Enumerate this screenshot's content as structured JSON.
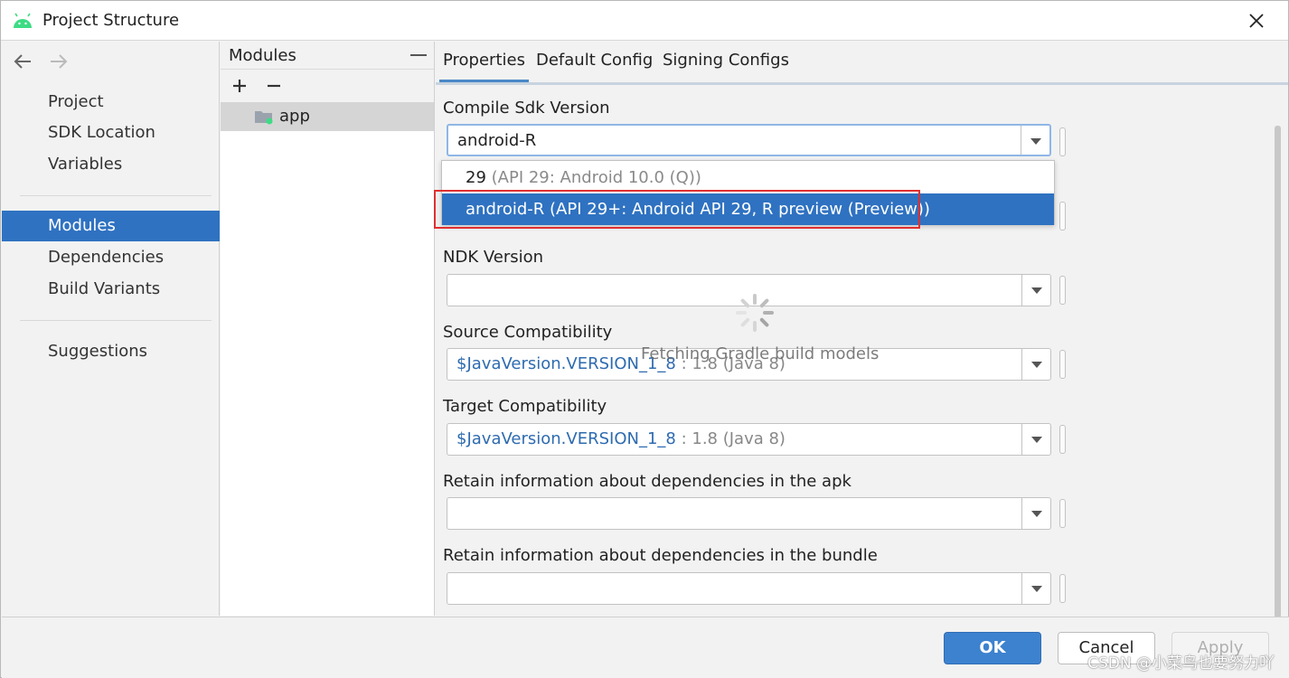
{
  "window": {
    "title": "Project Structure",
    "icon": "android-icon",
    "close_icon": "close-icon"
  },
  "nav": {
    "back_icon": "arrow-left-icon",
    "forward_icon": "arrow-right-icon",
    "group1": [
      "Project",
      "SDK Location",
      "Variables"
    ],
    "group2": [
      "Modules",
      "Dependencies",
      "Build Variants"
    ],
    "group3": [
      "Suggestions"
    ],
    "selected": "Modules",
    "selected_color": "#2f72c1"
  },
  "modules": {
    "title": "Modules",
    "add_icon": "plus-icon",
    "remove_icon": "minus-icon",
    "items": [
      {
        "label": "app",
        "icon": "module-folder-icon"
      }
    ]
  },
  "tabs": [
    "Properties",
    "Default Config",
    "Signing Configs"
  ],
  "active_tab": "Properties",
  "fields": {
    "compile_sdk": {
      "label": "Compile Sdk Version",
      "value": "android-R"
    },
    "ndk": {
      "label": "NDK Version",
      "value": ""
    },
    "source_compat": {
      "label": "Source Compatibility",
      "value_link": "$JavaVersion.VERSION_1_8",
      "value_dim": " : 1.8 (Java 8)"
    },
    "target_compat": {
      "label": "Target Compatibility",
      "value_link": "$JavaVersion.VERSION_1_8",
      "value_dim": " : 1.8 (Java 8)"
    },
    "retain_apk": {
      "label": "Retain information about dependencies in the apk",
      "value": ""
    },
    "retain_bundle": {
      "label": "Retain information about dependencies in the bundle",
      "value": ""
    }
  },
  "dropdown": {
    "items": [
      {
        "main": "29",
        "dim": " (API 29: Android 10.0 (Q))"
      },
      {
        "main": "android-R (API 29+: Android API 29, R preview (Preview))",
        "dim": ""
      }
    ],
    "selected_index": 1,
    "highlight_color": "#e03030"
  },
  "loading": {
    "text": "Fetching Gradle build models",
    "icon": "spinner-icon"
  },
  "buttons": {
    "ok": "OK",
    "cancel": "Cancel",
    "apply": "Apply"
  },
  "watermark": "CSDN @小菜鸟也要努力吖"
}
